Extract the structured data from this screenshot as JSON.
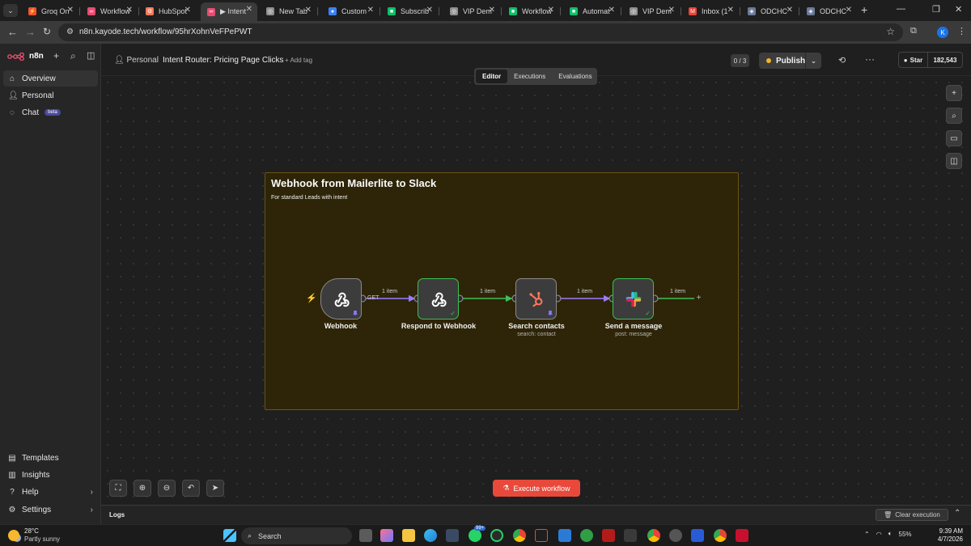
{
  "browser": {
    "tabs": [
      {
        "label": "Groq On",
        "color": "#f55036",
        "glyph": "⚡"
      },
      {
        "label": "Workflow",
        "color": "#ea4b71",
        "glyph": "∞"
      },
      {
        "label": "HubSpot",
        "color": "#ff7a59",
        "glyph": "⚙"
      },
      {
        "label": "▶ Intent",
        "color": "#ea4b71",
        "glyph": "∞"
      },
      {
        "label": "New Tab",
        "color": "#8f8f8f",
        "glyph": "◎"
      },
      {
        "label": "Custom",
        "color": "#3b82f6",
        "glyph": "●"
      },
      {
        "label": "Subscrib",
        "color": "#09c269",
        "glyph": "■"
      },
      {
        "label": "VIP Dem",
        "color": "#8f8f8f",
        "glyph": "◎"
      },
      {
        "label": "Workflow",
        "color": "#09c269",
        "glyph": "■"
      },
      {
        "label": "Automat",
        "color": "#09c269",
        "glyph": "■"
      },
      {
        "label": "VIP Dem",
        "color": "#8f8f8f",
        "glyph": "◎"
      },
      {
        "label": "Inbox (1",
        "color": "#ea4335",
        "glyph": "M"
      },
      {
        "label": "ODCHC",
        "color": "#6b7a99",
        "glyph": "◈"
      },
      {
        "label": "ODCHC",
        "color": "#6b7a99",
        "glyph": "◈"
      }
    ],
    "url": "n8n.kayode.tech/workflow/95hrXohnVeFPePWT",
    "profile_initial": "K"
  },
  "sidebar": {
    "logo_text": "n8n",
    "items": [
      {
        "label": "Overview",
        "icon": "home-icon"
      },
      {
        "label": "Personal",
        "icon": "user-icon"
      },
      {
        "label": "Chat",
        "icon": "chat-icon",
        "badge": "beta"
      }
    ],
    "footer_items": [
      {
        "label": "Templates",
        "icon": "templates-icon"
      },
      {
        "label": "Insights",
        "icon": "insights-icon"
      },
      {
        "label": "Help",
        "icon": "help-icon"
      },
      {
        "label": "Settings",
        "icon": "settings-icon"
      }
    ]
  },
  "header": {
    "breadcrumb": "Personal",
    "workflow_name": "Intent Router: Pricing Page Clicks",
    "add_tag": "+ Add tag",
    "counter": "0 / 3",
    "publish_label": "Publish",
    "github_star_label": "Star",
    "github_star_count": "182,543"
  },
  "view_tabs": [
    {
      "label": "Editor",
      "active": true
    },
    {
      "label": "Executions",
      "active": false
    },
    {
      "label": "Evaluations",
      "active": false
    }
  ],
  "canvas": {
    "sticky": {
      "title": "Webhook from Mailerlite to Slack",
      "subtitle": "For standard Leads with intent",
      "color": "#2e2508"
    },
    "nodes": [
      {
        "label": "Webhook",
        "subtitle": "",
        "icon": "webhook-icon"
      },
      {
        "label": "Respond to Webhook",
        "subtitle": "",
        "icon": "webhook-icon"
      },
      {
        "label": "Search contacts",
        "subtitle": "search: contact",
        "icon": "hubspot-icon"
      },
      {
        "label": "Send a message",
        "subtitle": "post: message",
        "icon": "slack-icon"
      }
    ],
    "edges": [
      {
        "label": "1 item",
        "method": "GET"
      },
      {
        "label": "1 item"
      },
      {
        "label": "1 item"
      },
      {
        "label": "1 item"
      }
    ],
    "execute_label": "Execute workflow"
  },
  "logs": {
    "label": "Logs",
    "clear_label": "Clear execution"
  },
  "taskbar": {
    "temperature": "28°C",
    "weather": "Partly sunny",
    "search_placeholder": "Search",
    "battery": "55%",
    "time": "9:39 AM",
    "date": "4/7/2026",
    "notification_badge": "99+"
  },
  "colors": {
    "accent": "#e8493a",
    "success": "#3fbf56",
    "publish_dot": "#f0b429"
  }
}
